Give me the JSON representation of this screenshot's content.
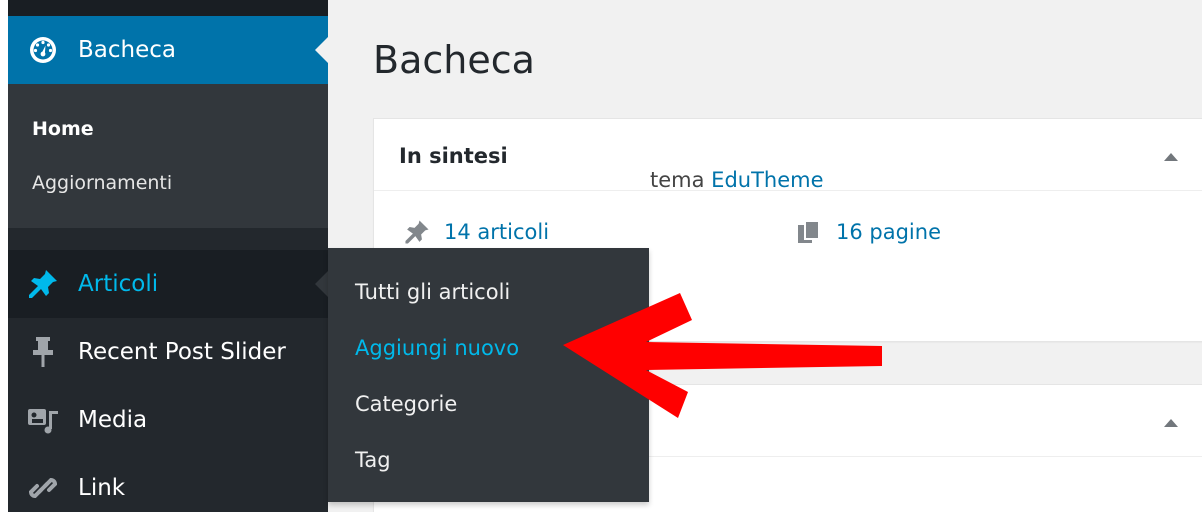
{
  "sidebar": {
    "dashboard_label": "Bacheca",
    "submenu": [
      "Home",
      "Aggiornamenti"
    ],
    "posts_label": "Articoli",
    "recent_post_slider_label": "Recent Post Slider",
    "media_label": "Media",
    "link_label": "Link"
  },
  "flyout": {
    "items": [
      "Tutti gli articoli",
      "Aggiungi nuovo",
      "Categorie",
      "Tag"
    ]
  },
  "main": {
    "title": "Bacheca",
    "glance": {
      "title": "In sintesi",
      "posts_count": "14 articoli",
      "pages_count": "16 pagine",
      "theme_prefix": "tema",
      "theme_name": "EduTheme"
    }
  },
  "colors": {
    "sidebar_bg": "#23282d",
    "active_blue": "#0073aa",
    "hover_cyan": "#00b9eb",
    "flyout_bg": "#32373c",
    "arrow_red": "#ff0000"
  },
  "icons": {
    "dashboard": "dashboard-gauge-icon",
    "posts": "thumbtack-icon",
    "recent_post_slider": "pin-icon",
    "media": "media-icon",
    "link": "chain-link-icon",
    "pages": "pages-icon",
    "toggle": "triangle-up-icon",
    "annotation": "red-arrow-icon"
  }
}
